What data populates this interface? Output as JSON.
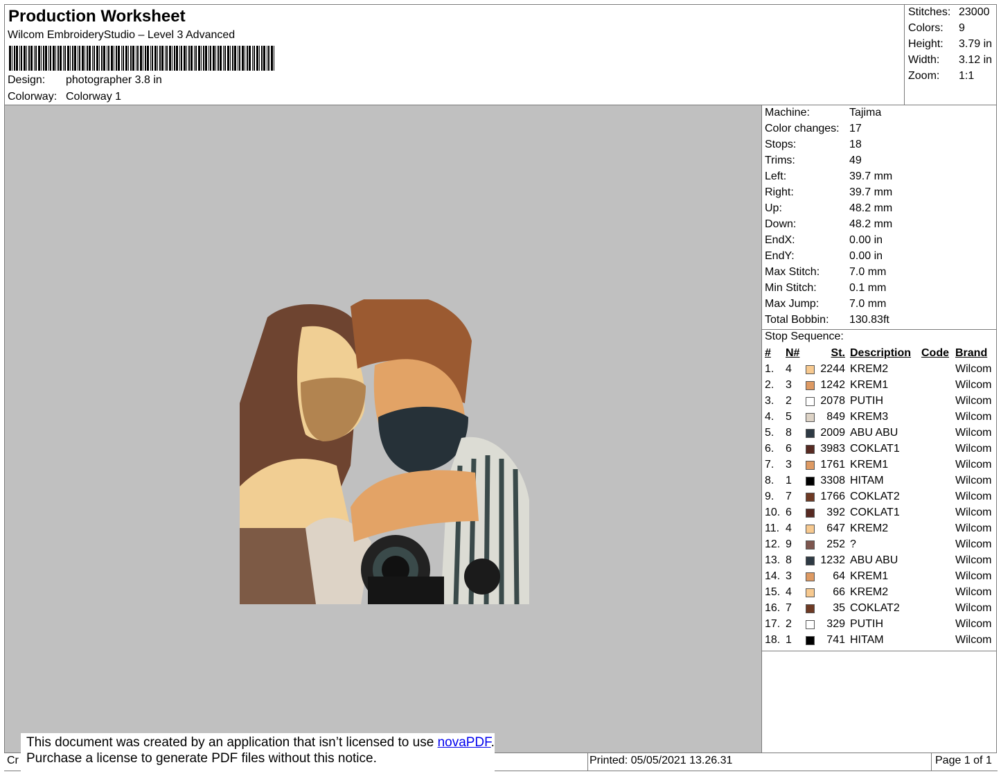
{
  "header": {
    "title": "Production Worksheet",
    "subtitle": "Wilcom EmbroideryStudio – Level 3 Advanced",
    "design_label": "Design:",
    "design_value": "photographer 3.8 in",
    "colorway_label": "Colorway:",
    "colorway_value": "Colorway 1"
  },
  "stats": [
    {
      "label": "Stitches:",
      "value": "23000"
    },
    {
      "label": "Colors:",
      "value": "9"
    },
    {
      "label": "Height:",
      "value": "3.79 in"
    },
    {
      "label": "Width:",
      "value": "3.12 in"
    },
    {
      "label": "Zoom:",
      "value": "1:1"
    }
  ],
  "machine_info": [
    {
      "label": "Machine:",
      "value": "Tajima"
    },
    {
      "label": "Color changes:",
      "value": "17"
    },
    {
      "label": "Stops:",
      "value": "18"
    },
    {
      "label": "Trims:",
      "value": "49"
    },
    {
      "label": "Left:",
      "value": "39.7 mm"
    },
    {
      "label": "Right:",
      "value": "39.7 mm"
    },
    {
      "label": "Up:",
      "value": "48.2 mm"
    },
    {
      "label": "Down:",
      "value": "48.2 mm"
    },
    {
      "label": "EndX:",
      "value": "0.00 in"
    },
    {
      "label": "EndY:",
      "value": "0.00 in"
    },
    {
      "label": "Max Stitch:",
      "value": "7.0 mm"
    },
    {
      "label": "Min Stitch:",
      "value": "0.1 mm"
    },
    {
      "label": "Max Jump:",
      "value": "7.0 mm"
    },
    {
      "label": "Total Bobbin:",
      "value": "130.83ft"
    }
  ],
  "stop_sequence": {
    "label": "Stop Sequence:",
    "headers": {
      "idx": "#",
      "n": "N#",
      "st": "St.",
      "desc": "Description",
      "code": "Code",
      "brand": "Brand"
    },
    "rows": [
      {
        "idx": "1.",
        "n": "4",
        "color": "#f7c98f",
        "st": "2244",
        "desc": "KREM2",
        "code": "",
        "brand": "Wilcom"
      },
      {
        "idx": "2.",
        "n": "3",
        "color": "#de9a63",
        "st": "1242",
        "desc": "KREM1",
        "code": "",
        "brand": "Wilcom"
      },
      {
        "idx": "3.",
        "n": "2",
        "color": "#ffffff",
        "st": "2078",
        "desc": "PUTIH",
        "code": "",
        "brand": "Wilcom"
      },
      {
        "idx": "4.",
        "n": "5",
        "color": "#ddd3c6",
        "st": "849",
        "desc": "KREM3",
        "code": "",
        "brand": "Wilcom"
      },
      {
        "idx": "5.",
        "n": "8",
        "color": "#2e3a44",
        "st": "2009",
        "desc": "ABU ABU",
        "code": "",
        "brand": "Wilcom"
      },
      {
        "idx": "6.",
        "n": "6",
        "color": "#572a22",
        "st": "3983",
        "desc": "COKLAT1",
        "code": "",
        "brand": "Wilcom"
      },
      {
        "idx": "7.",
        "n": "3",
        "color": "#de9a63",
        "st": "1761",
        "desc": "KREM1",
        "code": "",
        "brand": "Wilcom"
      },
      {
        "idx": "8.",
        "n": "1",
        "color": "#000000",
        "st": "3308",
        "desc": "HITAM",
        "code": "",
        "brand": "Wilcom"
      },
      {
        "idx": "9.",
        "n": "7",
        "color": "#6e3a24",
        "st": "1766",
        "desc": "COKLAT2",
        "code": "",
        "brand": "Wilcom"
      },
      {
        "idx": "10.",
        "n": "6",
        "color": "#572a22",
        "st": "392",
        "desc": "COKLAT1",
        "code": "",
        "brand": "Wilcom"
      },
      {
        "idx": "11.",
        "n": "4",
        "color": "#f7c98f",
        "st": "647",
        "desc": "KREM2",
        "code": "",
        "brand": "Wilcom"
      },
      {
        "idx": "12.",
        "n": "9",
        "color": "#7e574f",
        "st": "252",
        "desc": "?",
        "code": "",
        "brand": "Wilcom"
      },
      {
        "idx": "13.",
        "n": "8",
        "color": "#2e3a44",
        "st": "1232",
        "desc": "ABU ABU",
        "code": "",
        "brand": "Wilcom"
      },
      {
        "idx": "14.",
        "n": "3",
        "color": "#de9a63",
        "st": "64",
        "desc": "KREM1",
        "code": "",
        "brand": "Wilcom"
      },
      {
        "idx": "15.",
        "n": "4",
        "color": "#f7c98f",
        "st": "66",
        "desc": "KREM2",
        "code": "",
        "brand": "Wilcom"
      },
      {
        "idx": "16.",
        "n": "7",
        "color": "#6e3a24",
        "st": "35",
        "desc": "COKLAT2",
        "code": "",
        "brand": "Wilcom"
      },
      {
        "idx": "17.",
        "n": "2",
        "color": "#ffffff",
        "st": "329",
        "desc": "PUTIH",
        "code": "",
        "brand": "Wilcom"
      },
      {
        "idx": "18.",
        "n": "1",
        "color": "#000000",
        "st": "741",
        "desc": "HITAM",
        "code": "",
        "brand": "Wilcom"
      }
    ]
  },
  "notice": {
    "line1": "This document was created by an application that isn’t licensed to use",
    "link": "novaPDF",
    "line1_end": ".",
    "line2": "Purchase a license to generate PDF files without this notice."
  },
  "footer": {
    "left": "Cr",
    "printed": "Printed: 05/05/2021 13.26.31",
    "page": "Page 1 of 1"
  }
}
